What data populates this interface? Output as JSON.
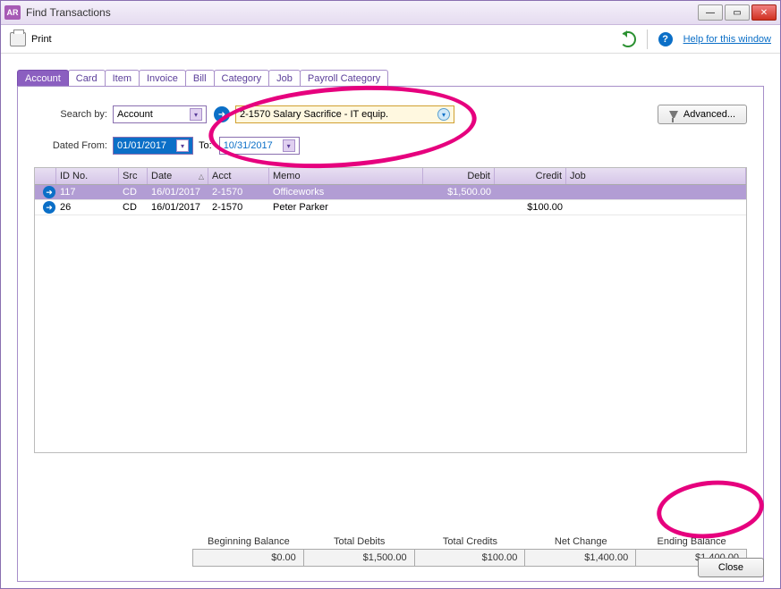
{
  "window": {
    "app_badge": "AR",
    "title": "Find Transactions"
  },
  "toolbar": {
    "print_label": "Print",
    "help_label": "Help for this window",
    "help_mark": "?"
  },
  "tabs": [
    "Account",
    "Card",
    "Item",
    "Invoice",
    "Bill",
    "Category",
    "Job",
    "Payroll Category"
  ],
  "search": {
    "search_by_label": "Search by:",
    "search_by_value": "Account",
    "account_value": "2-1570 Salary Sacrifice - IT equip.",
    "dated_from_label": "Dated From:",
    "date_from": "01/01/2017",
    "to_label": "To:",
    "date_to": "10/31/2017",
    "advanced_btn": "Advanced..."
  },
  "grid": {
    "headers": {
      "id": "ID No.",
      "src": "Src",
      "date": "Date",
      "acct": "Acct",
      "memo": "Memo",
      "debit": "Debit",
      "credit": "Credit",
      "job": "Job"
    },
    "rows": [
      {
        "id": "117",
        "src": "CD",
        "date": "16/01/2017",
        "acct": "2-1570",
        "memo": "Officeworks",
        "debit": "$1,500.00",
        "credit": "",
        "job": "",
        "selected": true
      },
      {
        "id": "26",
        "src": "CD",
        "date": "16/01/2017",
        "acct": "2-1570",
        "memo": "Peter Parker",
        "debit": "",
        "credit": "$100.00",
        "job": "",
        "selected": false
      }
    ]
  },
  "summary": {
    "labels": {
      "beg": "Beginning Balance",
      "debits": "Total Debits",
      "credits": "Total Credits",
      "net": "Net Change",
      "end": "Ending Balance"
    },
    "values": {
      "beg": "$0.00",
      "debits": "$1,500.00",
      "credits": "$100.00",
      "net": "$1,400.00",
      "end": "$1,400.00"
    }
  },
  "close_label": "Close"
}
